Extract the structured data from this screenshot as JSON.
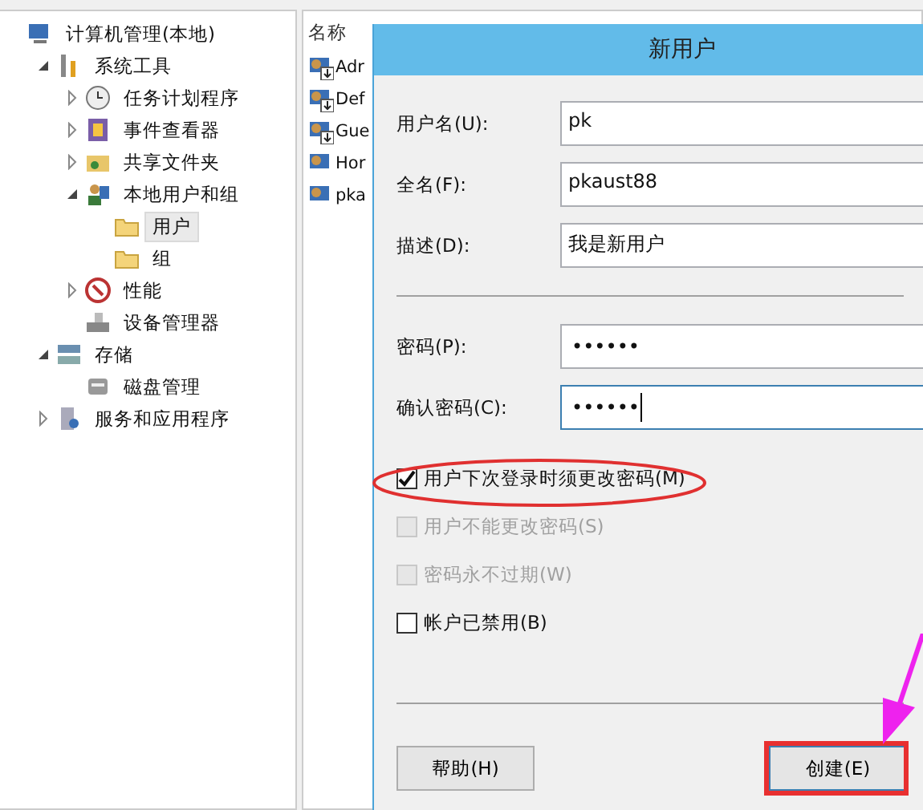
{
  "tree": [
    {
      "label": "计算机管理(本地)",
      "kind": "computer",
      "selected": false,
      "children": [
        {
          "label": "系统工具",
          "kind": "tools",
          "selected": false,
          "expanded": true,
          "children": [
            {
              "label": "任务计划程序",
              "kind": "clock",
              "selected": false,
              "expanded": false
            },
            {
              "label": "事件查看器",
              "kind": "log",
              "selected": false,
              "expanded": false
            },
            {
              "label": "共享文件夹",
              "kind": "share",
              "selected": false,
              "expanded": false
            },
            {
              "label": "本地用户和组",
              "kind": "users",
              "selected": false,
              "expanded": true,
              "children": [
                {
                  "label": "用户",
                  "kind": "folder",
                  "selected": true
                },
                {
                  "label": "组",
                  "kind": "folder",
                  "selected": false
                }
              ]
            },
            {
              "label": "性能",
              "kind": "perf",
              "selected": false,
              "expanded": false
            },
            {
              "label": "设备管理器",
              "kind": "device",
              "selected": false
            }
          ]
        },
        {
          "label": "存储",
          "kind": "storage",
          "selected": false,
          "expanded": true,
          "children": [
            {
              "label": "磁盘管理",
              "kind": "disk",
              "selected": false
            }
          ]
        },
        {
          "label": "服务和应用程序",
          "kind": "services",
          "selected": false,
          "expanded": false
        }
      ]
    }
  ],
  "list": {
    "column": "名称",
    "rows": [
      {
        "name": "Adr",
        "disabled": true
      },
      {
        "name": "Def",
        "disabled": true
      },
      {
        "name": "Gue",
        "disabled": true
      },
      {
        "name": "Hor",
        "disabled": false
      },
      {
        "name": "pka",
        "disabled": false
      }
    ]
  },
  "dialog": {
    "title": "新用户",
    "fields": [
      {
        "label": "用户名(U):",
        "value": "pk"
      },
      {
        "label": "全名(F):",
        "value": "pkaust88"
      },
      {
        "label": "描述(D):",
        "value": "我是新用户"
      }
    ],
    "passwords": [
      {
        "label": "密码(P):",
        "value": "••••••",
        "focused": false
      },
      {
        "label": "确认密码(C):",
        "value": "••••••",
        "focused": true
      }
    ],
    "options": [
      {
        "label": "用户下次登录时须更改密码(M)",
        "checked": true,
        "disabled": false
      },
      {
        "label": "用户不能更改密码(S)",
        "checked": false,
        "disabled": true
      },
      {
        "label": "密码永不过期(W)",
        "checked": false,
        "disabled": true
      },
      {
        "label": "帐户已禁用(B)",
        "checked": false,
        "disabled": false
      }
    ],
    "buttons": [
      {
        "label": "帮助(H)",
        "kind": "help"
      },
      {
        "label": "创建(E)",
        "kind": "create"
      }
    ]
  }
}
